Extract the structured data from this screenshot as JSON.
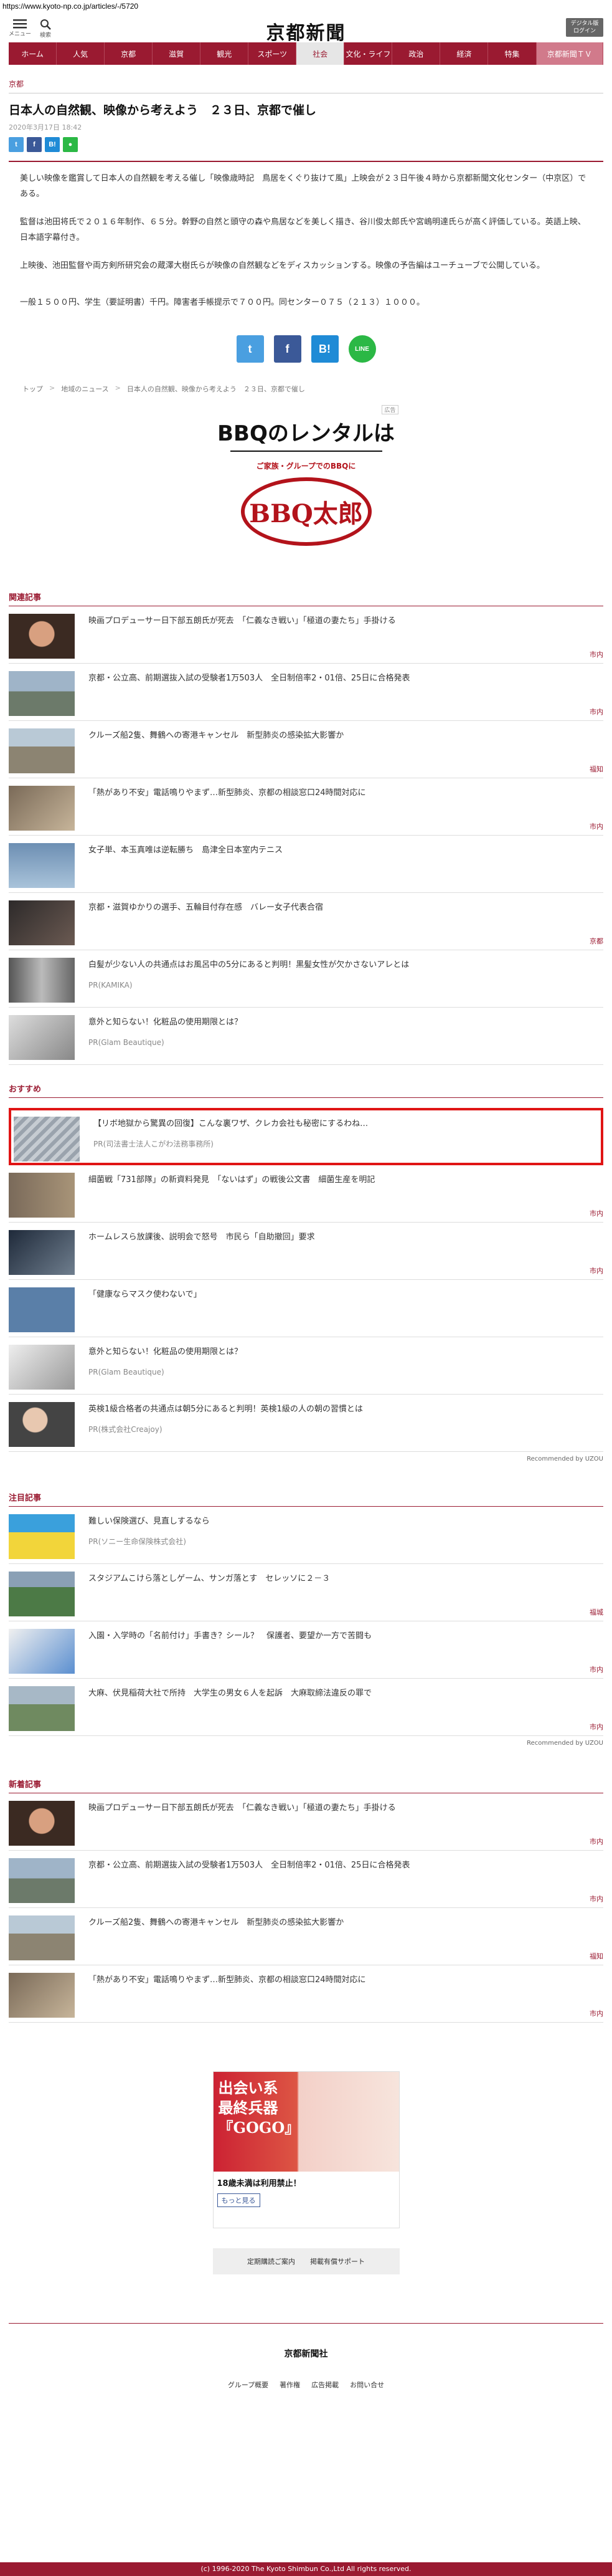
{
  "url": "https://www.kyoto-np.co.jp/articles/-/5720",
  "header": {
    "menu_label": "メニュー",
    "search_label": "検索",
    "logo": "京都新聞",
    "digital_btn_line1": "デジタル版",
    "digital_btn_line2": "ログイン"
  },
  "nav": [
    "ホーム",
    "人気",
    "京都",
    "滋賀",
    "観光",
    "スポーツ",
    "社会",
    "文化・ライフ",
    "政治",
    "経済",
    "特集",
    "京都新聞ＴＶ"
  ],
  "article": {
    "category": "京都",
    "title": "日本人の自然観、映像から考えよう　２３日、京都で催し",
    "date": "2020年3月17日 18:42",
    "paragraphs": [
      "美しい映像を鑑賞して日本人の自然観を考える催し「映像歳時記　鳥居をくぐり抜けて風」上映会が２３日午後４時から京都新聞文化センター（中京区）である。",
      "監督は池田将氏で２０１６年制作、６５分。幹野の自然と頭守の森や鳥居などを美しく描き、谷川俊太郎氏や宮嶋明達氏らが高く評価している。英語上映、日本語字幕付き。",
      "上映後、池田監督や両方剣所研究会の蔵澤大樹氏らが映像の自然観などをディスカッションする。映像の予告編はユーチューブで公開している。",
      "一般１５００円、学生（要証明書）千円。障害者手帳提示で７００円。同センター０７５（２１３）１０００。"
    ]
  },
  "share": {
    "twitter": "t",
    "facebook": "f",
    "hatena": "B!",
    "line": "LINE"
  },
  "breadcrumb": [
    "トップ",
    "地域のニュース",
    "日本人の自然観、映像から考えよう　２３日、京都で催し"
  ],
  "ad1": {
    "label": "広告",
    "title": "BBQのレンタルは",
    "sub": "ご家族・グループでのBBQに",
    "brand": "BBQ太郎"
  },
  "related": {
    "head": "関連記事",
    "items": [
      {
        "text": "映画プロデューサー日下部五朗氏が死去　「仁義なき戦い」「極道の妻たち」手掛ける",
        "tag": "市内"
      },
      {
        "text": "京都・公立高、前期選抜入試の受験者1万503人　全日制倍率2・01倍、25日に合格発表",
        "tag": "市内"
      },
      {
        "text": "クルーズ船2隻、舞鶴への寄港キャンセル　新型肺炎の感染拡大影響か",
        "tag": "福知"
      },
      {
        "text": "「熱があり不安」電話鳴りやまず…新型肺炎、京都の相談窓口24時間対応に",
        "tag": "市内"
      },
      {
        "text": "女子単、本玉真唯は逆転勝ち　島津全日本室内テニス",
        "tag": ""
      },
      {
        "text": "京都・滋賀ゆかりの選手、五輪目付存在感　バレー女子代表合宿",
        "tag": "京都"
      },
      {
        "text": "白髪が少ない人の共通点はお風呂中の5分にあると判明！黒髪女性が欠かさないアレとは",
        "pr": "PR(KAMIKA)",
        "tag": ""
      },
      {
        "text": "意外と知らない！化粧品の使用期限とは？",
        "pr": "PR(Glam Beautique)",
        "tag": ""
      }
    ]
  },
  "recommend": {
    "head": "おすすめ",
    "items": [
      {
        "text": "【リボ地獄から驚異の回復】こんな裏ワザ、クレカ会社も秘密にするわね…",
        "pr": "PR(司法書士法人こがわ法務事務所)",
        "tag": ""
      },
      {
        "text": "細菌戦「731部隊」の新資料発見　「ないはず」の戦後公文書　細菌生産を明記",
        "tag": "市内"
      },
      {
        "text": "ホームレスら放課後、説明会で怒号　市民ら「自助撤回」要求",
        "tag": "市内"
      },
      {
        "text": "「健康ならマスク使わないで」",
        "tag": ""
      },
      {
        "text": "意外と知らない！化粧品の使用期限とは？",
        "pr": "PR(Glam Beautique)",
        "tag": ""
      },
      {
        "text": "英検1級合格者の共通点は朝5分にあると判明！英検1級の人の朝の習慣とは",
        "pr": "PR(株式会社Creajoy)",
        "tag": ""
      }
    ],
    "powered": "Recommended by UZOU"
  },
  "attention": {
    "head": "注目記事",
    "items": [
      {
        "text": "難しい保険選び、見直しするなら",
        "pr": "PR(ソニー生命保険株式会社)",
        "tag": ""
      },
      {
        "text": "スタジアムこけら落としゲーム、サンガ落とす　セレッソに２－３",
        "tag": "福城"
      },
      {
        "text": "入園・入学時の「名前付け」手書き？シール？　保護者、要望か一方で苦闘も",
        "tag": "市内"
      },
      {
        "text": "大麻、伏見稲荷大社で所持　大学生の男女６人を起訴　大麻取締法違反の罪で",
        "tag": "市内"
      }
    ],
    "powered": "Recommended by UZOU"
  },
  "latest": {
    "head": "新着記事",
    "items": [
      {
        "text": "映画プロデューサー日下部五朗氏が死去　「仁義なき戦い」「極道の妻たち」手掛ける",
        "tag": "市内"
      },
      {
        "text": "京都・公立高、前期選抜入試の受験者1万503人　全日制倍率2・01倍、25日に合格発表",
        "tag": "市内"
      },
      {
        "text": "クルーズ船2隻、舞鶴への寄港キャンセル　新型肺炎の感染拡大影響か",
        "tag": "福知"
      },
      {
        "text": "「熱があり不安」電話鳴りやまず…新型肺炎、京都の相談窓口24時間対応に",
        "tag": "市内"
      }
    ]
  },
  "ad2": {
    "big": "出会い系\n最終兵器\n『GOGO』",
    "text": "18歳未満は利用禁止！",
    "more": "もっと見る"
  },
  "footer": {
    "links": [
      "定期購読ご案内",
      "掲載有償サポート"
    ],
    "logo": "京都新聞社",
    "nav": [
      "グループ概要",
      "著作権",
      "広告掲載",
      "お問い合せ"
    ],
    "copyright": "(c) 1996-2020 The Kyoto Shimbun Co.,Ltd All rights reserved."
  },
  "colors": {
    "brand": "#9a1a31",
    "highlight": "#e01515"
  }
}
